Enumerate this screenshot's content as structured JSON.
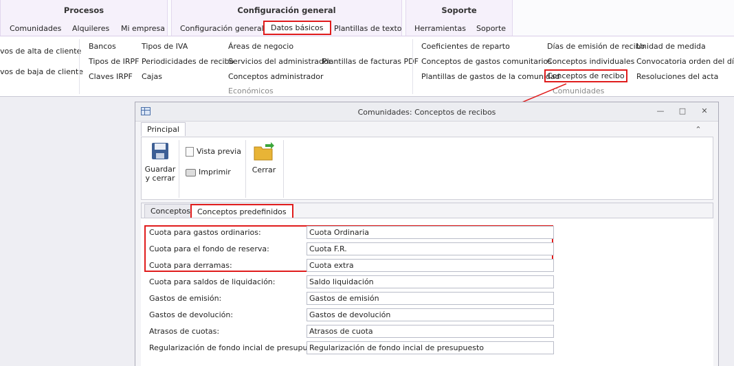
{
  "ribbon": {
    "groups": [
      {
        "title": "Procesos",
        "tabs": [
          "Comunidades",
          "Alquileres",
          "Mi empresa"
        ]
      },
      {
        "title": "Configuración general",
        "tabs": [
          "Configuración general",
          "Datos básicos",
          "Plantillas de texto"
        ]
      },
      {
        "title": "Soporte",
        "tabs": [
          "Herramientas",
          "Soporte"
        ]
      }
    ],
    "selected_tab": "Datos básicos",
    "items": {
      "motivos_alta": "vos de alta de cliente",
      "motivos_baja": "vos de baja de cliente",
      "bancos": "Bancos",
      "tipos_irpf": "Tipos de IRPF",
      "claves_irpf": "Claves IRPF",
      "tipos_iva": "Tipos de IVA",
      "periodicidades": "Periodicidades de recibo",
      "cajas": "Cajas",
      "areas_negocio": "Áreas de negocio",
      "servicios_admin": "Servicios del administrador",
      "conceptos_admin": "Conceptos administrador",
      "plantillas_facturas": "Plantillas de facturas PDF",
      "coeficientes": "Coeficientes de reparto",
      "conceptos_gastos": "Conceptos de gastos comunitarios",
      "plantillas_gastos": "Plantillas de gastos de la comunidad",
      "dias_emision": "Días de emisión de recibo",
      "conceptos_individuales": "Conceptos individuales",
      "conceptos_recibo": "Conceptos de recibo",
      "unidad_medida": "Unidad de medida",
      "convocatoria": "Convocatoria orden del día",
      "resoluciones": "Resoluciones del acta"
    },
    "group_labels": {
      "economicos": "Económicos",
      "comunidades": "Comunidades"
    }
  },
  "window": {
    "title": "Comunidades: Conceptos de recibos",
    "ribbon_tab": "Principal",
    "toolbar": {
      "save_close": "Guardar y cerrar",
      "preview": "Vista previa",
      "print": "Imprimir",
      "close": "Cerrar"
    },
    "tabs": [
      "Conceptos",
      "Conceptos predefinidos"
    ],
    "selected_tab": "Conceptos predefinidos",
    "fields": [
      {
        "label": "Cuota para gastos ordinarios:",
        "value": "Cuota Ordinaria"
      },
      {
        "label": "Cuota para el fondo de reserva:",
        "value": "Cuota F.R."
      },
      {
        "label": "Cuota para derramas:",
        "value": "Cuota extra"
      },
      {
        "label": "Cuota para saldos de liquidación:",
        "value": "Saldo liquidación"
      },
      {
        "label": "Gastos de emisión:",
        "value": "Gastos de emisión"
      },
      {
        "label": "Gastos de devolución:",
        "value": "Gastos de devolución"
      },
      {
        "label": "Atrasos de cuotas:",
        "value": "Atrasos de cuota"
      },
      {
        "label": "Regularización de fondo incial de presupuesto:",
        "value": "Regularización de fondo incial de presupuesto"
      }
    ]
  },
  "colors": {
    "highlight": "#e01b1b",
    "ribbon_header": "#f6f1fb"
  },
  "icons": [
    "floppy-disk-icon",
    "magnifier-page-icon",
    "printer-icon",
    "folder-exit-icon",
    "grid-icon",
    "minimize-icon",
    "restore-icon",
    "close-icon",
    "collapse-ribbon-icon"
  ]
}
